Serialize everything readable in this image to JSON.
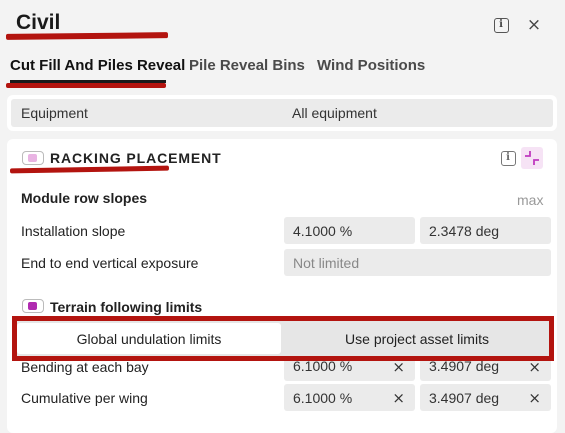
{
  "header": {
    "title": "Civil"
  },
  "tabs": [
    {
      "label": "Cut Fill And Piles Reveal",
      "active": true
    },
    {
      "label": "Pile Reveal Bins",
      "active": false
    },
    {
      "label": "Wind Positions",
      "active": false
    }
  ],
  "equipment": {
    "label": "Equipment",
    "value": "All equipment"
  },
  "racking": {
    "title": "RACKING PLACEMENT",
    "toggle_color": "#e9b4e3",
    "accent_color": "#c03abf"
  },
  "module_row_slopes": {
    "heading": "Module row slopes",
    "max_label": "max",
    "installation_slope": {
      "label": "Installation slope",
      "percent": "4.1000 %",
      "deg": "2.3478 deg"
    },
    "end_to_end": {
      "label": "End to end vertical exposure",
      "value": "Not limited"
    }
  },
  "terrain": {
    "heading": "Terrain following limits",
    "toggle_color": "#b02bb0",
    "segments": [
      {
        "label": "Global undulation limits",
        "active": true
      },
      {
        "label": "Use project asset limits",
        "active": false
      }
    ],
    "bending": {
      "label": "Bending at each bay",
      "percent": "6.1000 %",
      "deg": "3.4907 deg"
    },
    "cumulative": {
      "label": "Cumulative per wing",
      "percent": "6.1000 %",
      "deg": "3.4907 deg"
    }
  },
  "icons": {
    "clear": "×",
    "close": "×",
    "info": "i"
  }
}
